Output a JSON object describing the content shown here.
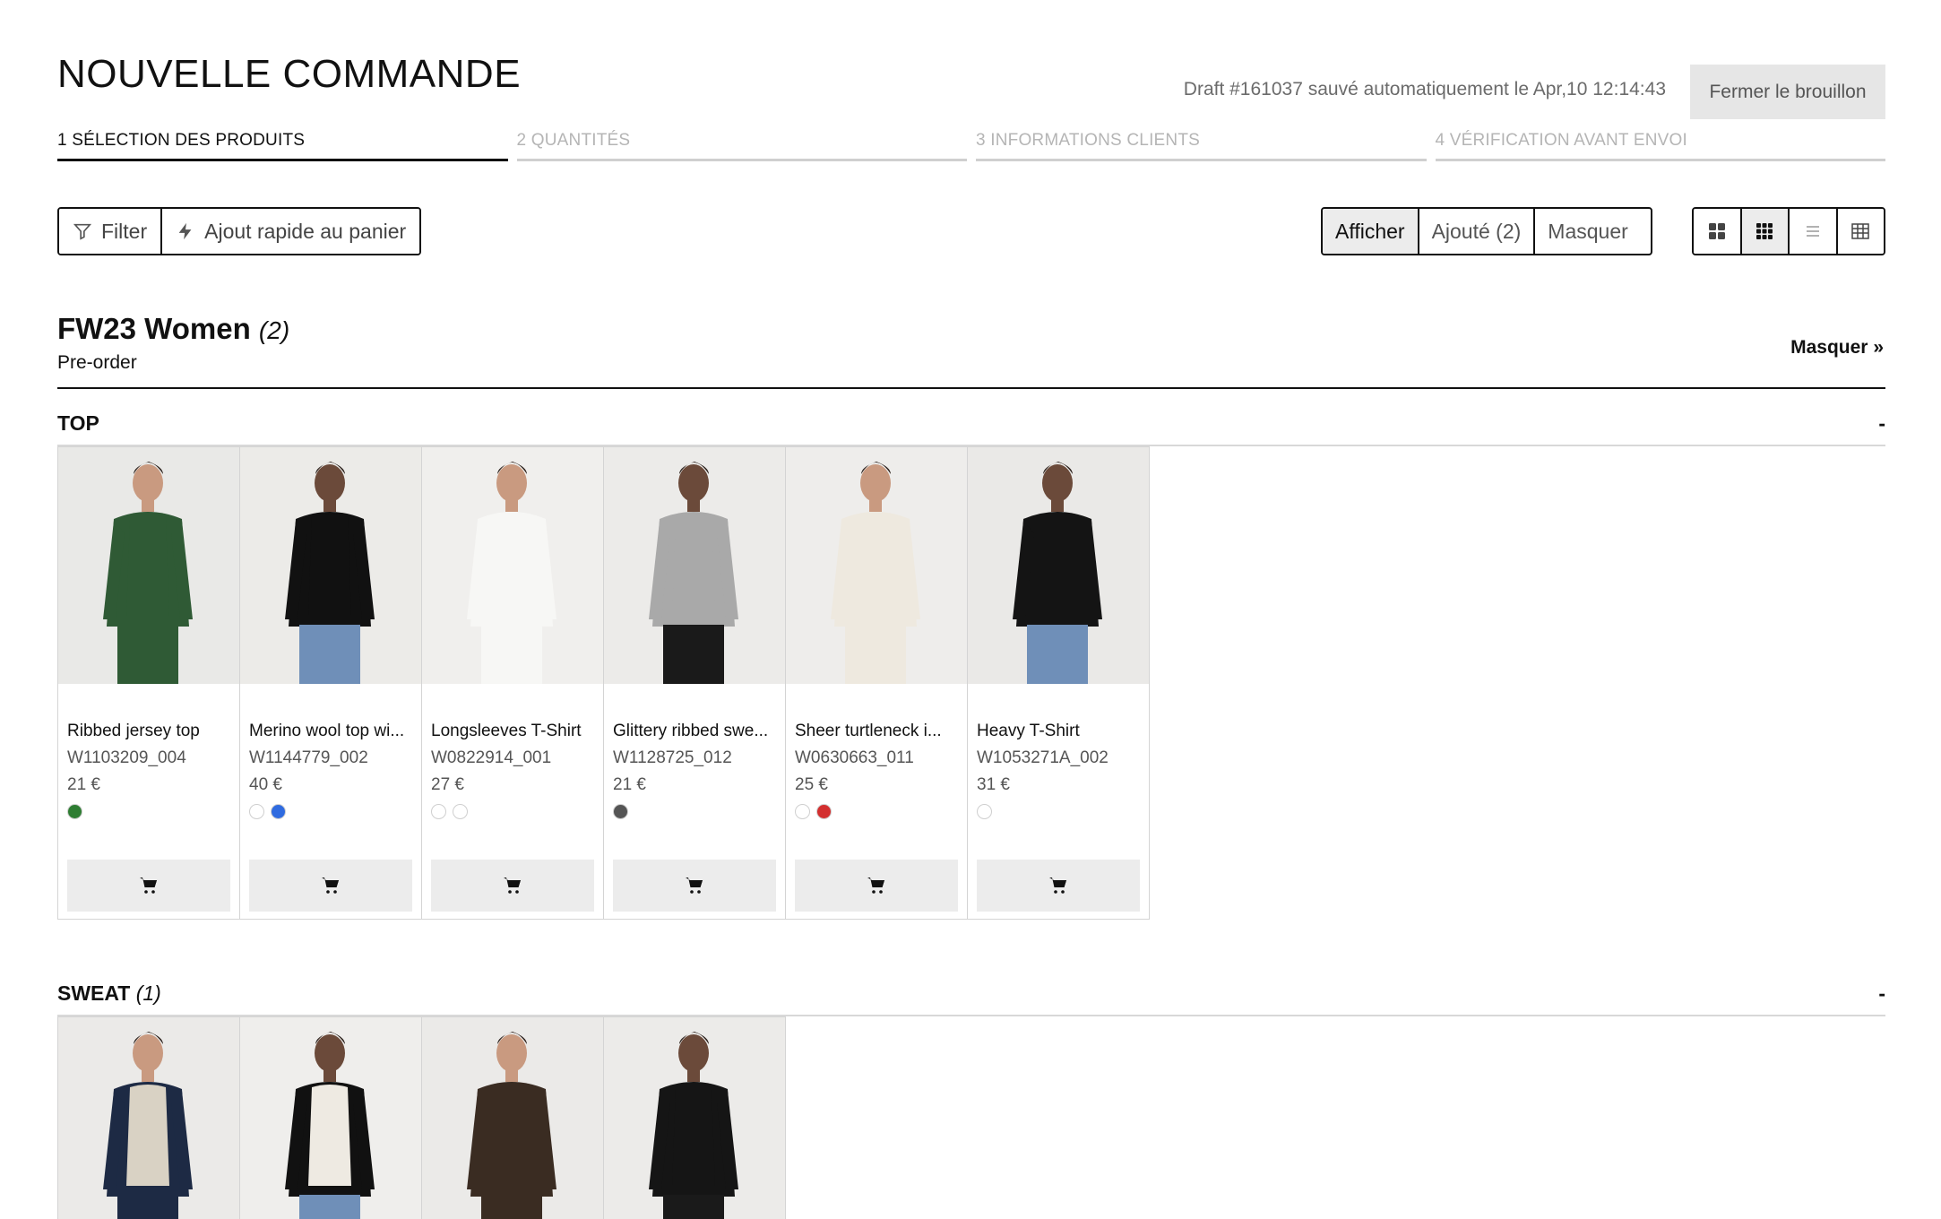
{
  "header": {
    "title": "NOUVELLE COMMANDE",
    "draft_status": "Draft #161037 sauvé automatiquement le Apr,10 12:14:43",
    "close_draft_label": "Fermer le brouillon"
  },
  "steps": [
    {
      "label": "1 SÉLECTION DES PRODUITS"
    },
    {
      "label": "2 QUANTITÉS"
    },
    {
      "label": "3 INFORMATIONS CLIENTS"
    },
    {
      "label": "4 VÉRIFICATION AVANT ENVOI"
    }
  ],
  "toolbar": {
    "filter_label": "Filter",
    "quick_add_label": "Ajout rapide au panier",
    "show_label": "Afficher",
    "added_label": "Ajouté (2)",
    "hide_label": "Masquer"
  },
  "collection": {
    "title": "FW23 Women",
    "count": "(2)",
    "subtitle": "Pre-order",
    "hide_label": "Masquer »"
  },
  "categories": [
    {
      "name": "TOP",
      "count": "",
      "collapse": "-",
      "products": [
        {
          "name": "Ribbed jersey top",
          "sku": "W1103209_004",
          "price": "21 €",
          "swatches": [
            "#2e7d32"
          ],
          "image_tone": "#e9e9e7",
          "garment": "#2f5a35"
        },
        {
          "name": "Merino wool top wi...",
          "sku": "W1144779_002",
          "price": "40 €",
          "swatches": [
            "#ffffff",
            "#2f6be0"
          ],
          "image_tone": "#ecebe8",
          "garment": "#111111"
        },
        {
          "name": "Longsleeves T-Shirt",
          "sku": "W0822914_001",
          "price": "27 €",
          "swatches": [
            "#ffffff",
            "#ffffff"
          ],
          "image_tone": "#f0efed",
          "garment": "#f7f7f5"
        },
        {
          "name": "Glittery ribbed swe...",
          "sku": "W1128725_012",
          "price": "21 €",
          "swatches": [
            "#555555"
          ],
          "image_tone": "#ecebe9",
          "garment": "#a9a9a9"
        },
        {
          "name": "Sheer turtleneck i...",
          "sku": "W0630663_011",
          "price": "25 €",
          "swatches": [
            "#ffffff",
            "#d32f2f"
          ],
          "image_tone": "#eeedeb",
          "garment": "#eee9df"
        },
        {
          "name": "Heavy T-Shirt",
          "sku": "W1053271A_002",
          "price": "31 €",
          "swatches": [
            "#ffffff"
          ],
          "image_tone": "#eae9e7",
          "garment": "#141414"
        }
      ]
    },
    {
      "name": "SWEAT",
      "count": "(1)",
      "collapse": "-",
      "products": [
        {
          "image_tone": "#ebeae8",
          "garment": "#d9d2c4",
          "outer": "#1d2a44"
        },
        {
          "image_tone": "#efeeec",
          "garment": "#eeeae2",
          "outer": "#111111"
        },
        {
          "image_tone": "#ebeae8",
          "garment": "#3a2c22",
          "outer": "#3a2c22"
        },
        {
          "image_tone": "#ecebe9",
          "garment": "#151515",
          "outer": "#151515"
        }
      ]
    }
  ],
  "icons": {
    "filter": "filter-icon",
    "quick_add": "lightning-icon",
    "view_large_grid": "grid-large-icon",
    "view_small_grid": "grid-small-icon",
    "view_list": "list-icon",
    "view_table": "table-icon",
    "cart": "cart-icon"
  },
  "colors": {
    "accent": "#111111",
    "muted_text": "#6b6b6b",
    "inactive_step": "#b5b5b5",
    "button_bg": "#ececec"
  }
}
